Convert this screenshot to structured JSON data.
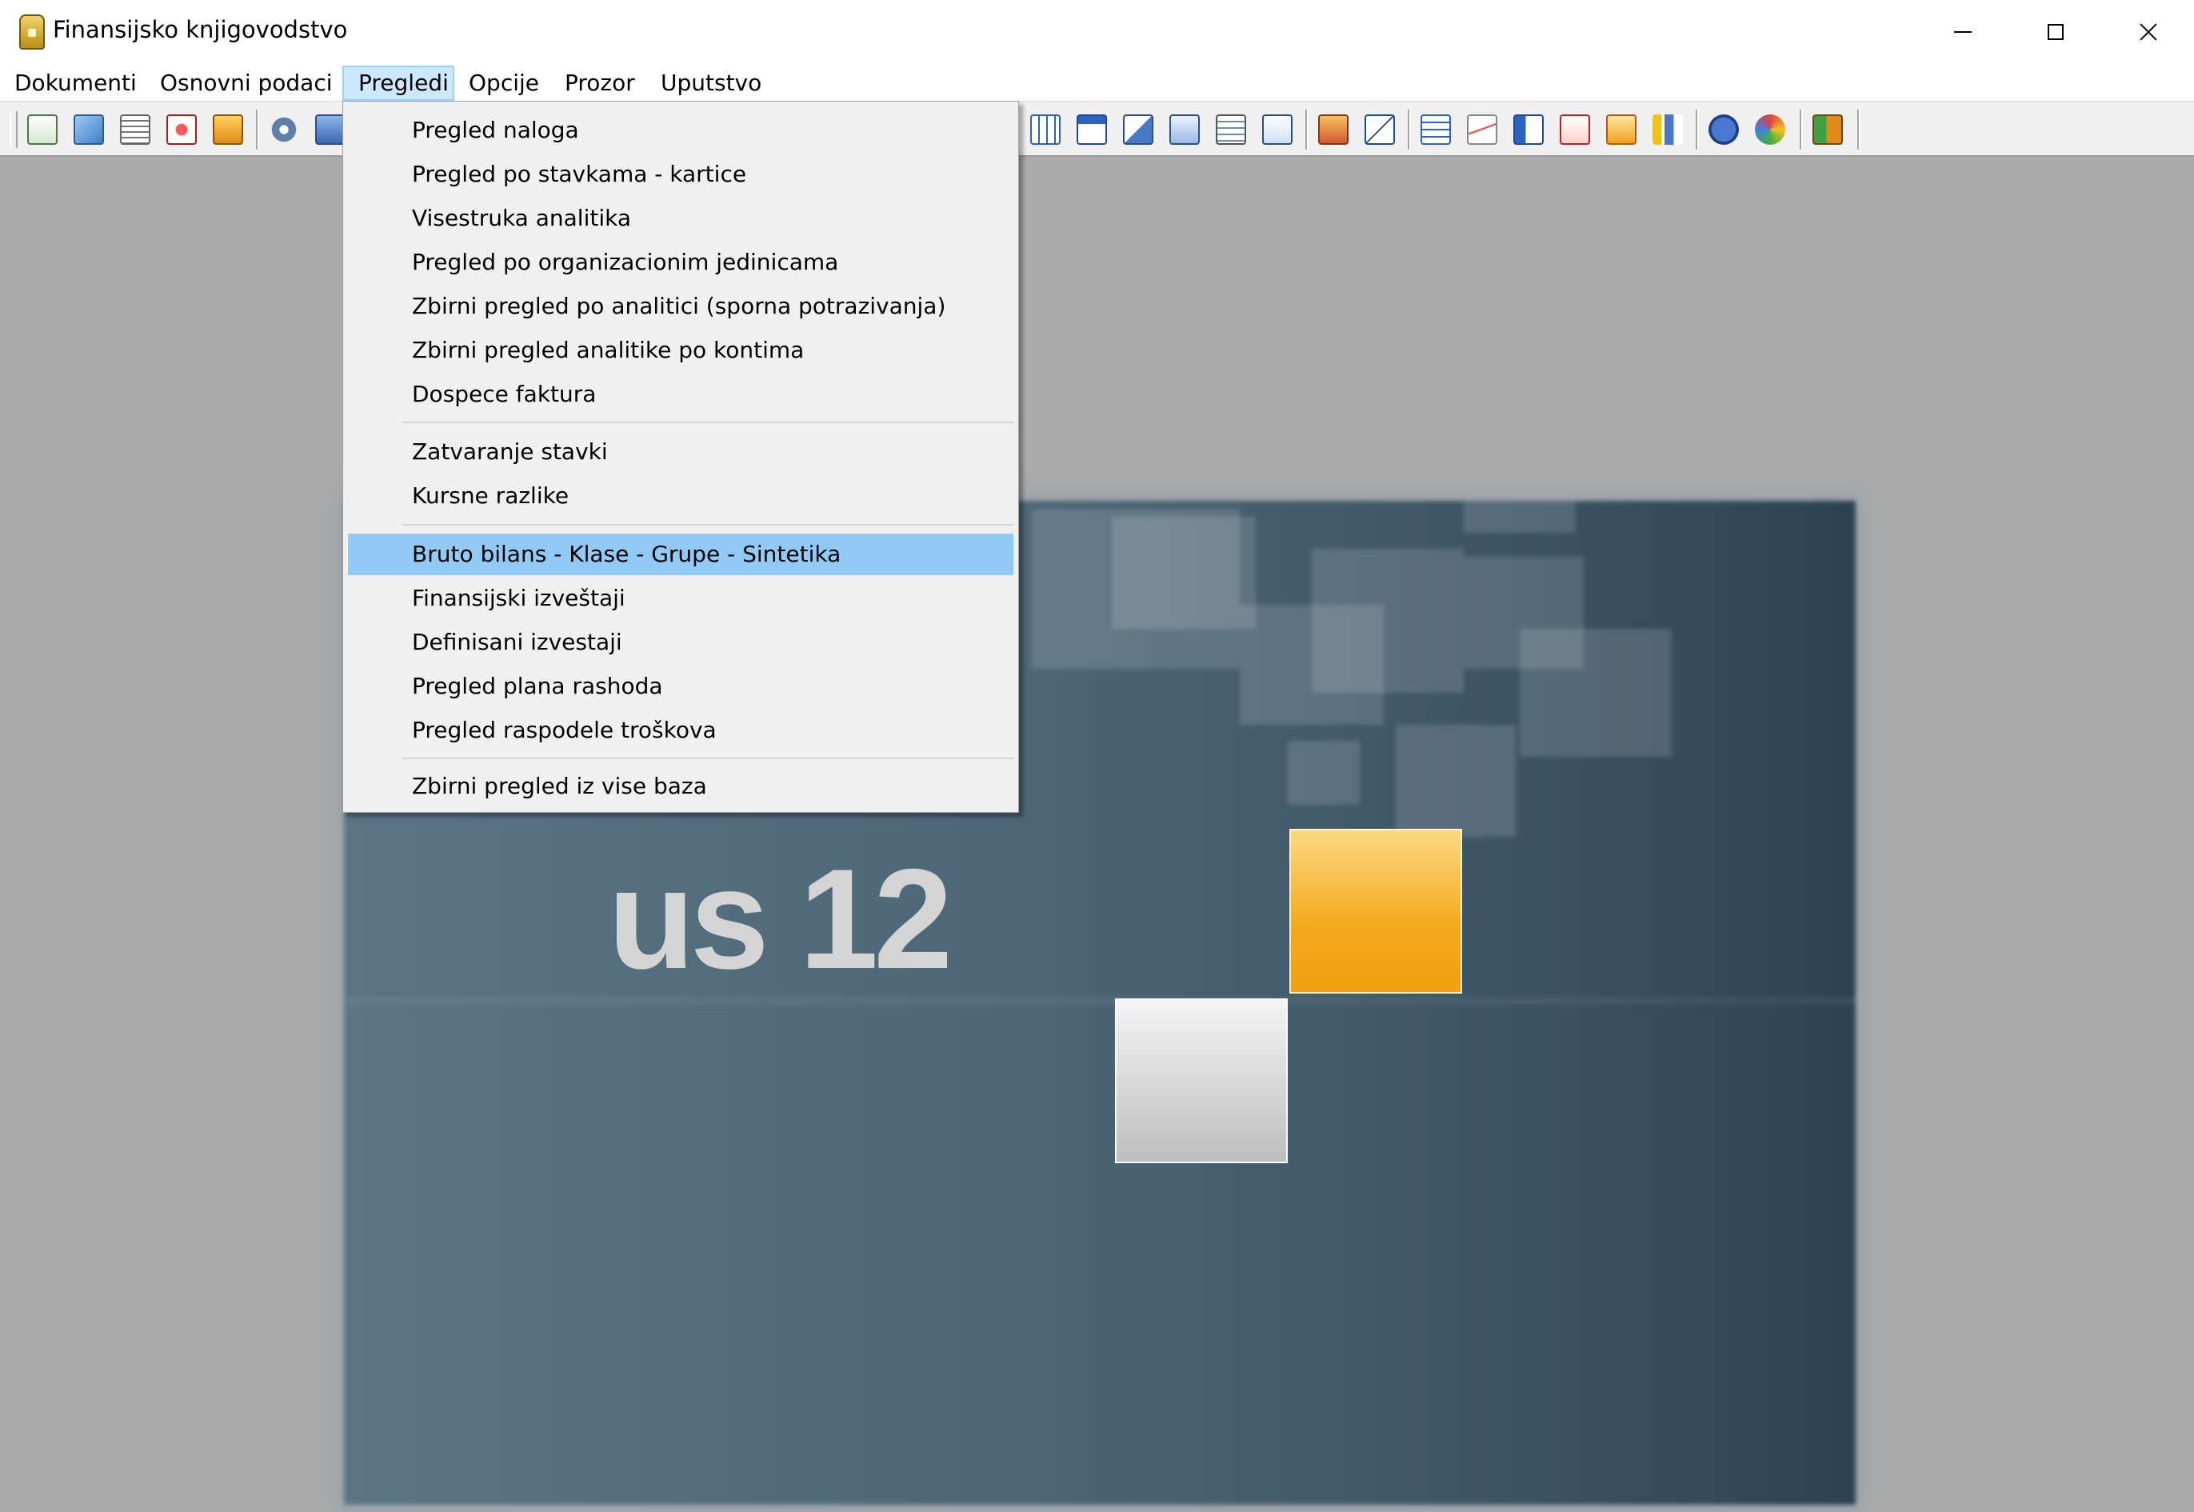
{
  "window": {
    "title": "Finansijsko knjigovodstvo",
    "icon": "app-jar-icon"
  },
  "menubar": {
    "items": [
      "Dokumenti",
      "Osnovni podaci",
      "Pregledi",
      "Opcije",
      "Prozor",
      "Uputstvo"
    ],
    "open_item": "Pregledi"
  },
  "dropdown": {
    "groups": [
      [
        "Pregled naloga",
        "Pregled po stavkama - kartice",
        "Visestruka analitika",
        "Pregled po organizacionim jedinicama",
        "Zbirni pregled po analitici (sporna potrazivanja)",
        "Zbirni pregled analitike po kontima",
        "Dospece faktura"
      ],
      [
        "Zatvaranje stavki",
        "Kursne razlike"
      ],
      [
        "Bruto bilans - Klase - Grupe - Sintetika",
        "Finansijski izveštaji",
        "Definisani izvestaji",
        "Pregled plana rashoda",
        "Pregled raspodele troškova"
      ],
      [
        "Zbirni pregled iz vise baza"
      ]
    ],
    "highlighted": "Bruto bilans - Klase - Grupe - Sintetika"
  },
  "splash": {
    "visible_text": "us 12"
  },
  "toolbar": {
    "icons": [
      "document-green-icon",
      "refresh-icon",
      "list-icon",
      "red-document-icon",
      "folder-icon",
      "gear-icon",
      "blue-window-icon",
      "grid-icon",
      "calendar-icon",
      "copy-windows-icon",
      "export-icon",
      "table-icon",
      "chart-window-icon",
      "folder-chart-icon",
      "plus-minus-icon",
      "table-blue-icon",
      "line-chart-icon",
      "tree-icon",
      "org-chart-red-icon",
      "org-chart-orange-icon",
      "bar-chart-icon",
      "help-icon",
      "color-wheel-icon",
      "exit-door-icon"
    ]
  },
  "colors": {
    "menu_open_bg": "#cce8ff",
    "menu_highlight": "#91c9f7",
    "workspace_bg": "#ababab",
    "splash_accent": "#f3a91c"
  }
}
